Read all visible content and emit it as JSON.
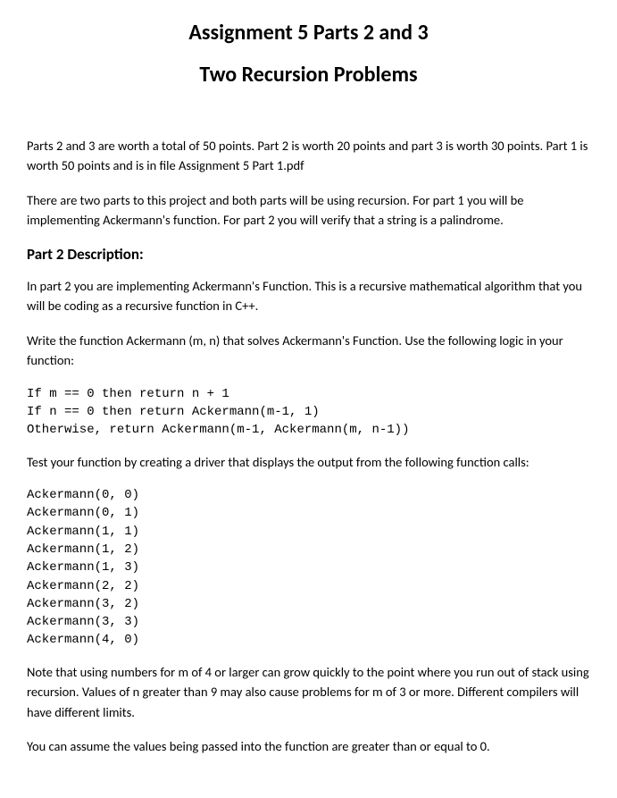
{
  "title": "Assignment 5 Parts 2 and 3",
  "subtitle": "Two Recursion Problems",
  "paragraphs": {
    "intro1": "Parts 2 and 3 are worth a total of 50 points. Part 2 is worth 20 points and part 3 is worth 30 points. Part 1 is worth 50 points and is in file Assignment 5 Part 1.pdf",
    "intro2": "There are two parts to this project and both parts will be using recursion. For part 1 you will be implementing Ackermann's function. For part 2 you will verify that a string is a palindrome.",
    "part2_heading": "Part 2 Description:",
    "part2_p1": "In part 2 you are implementing Ackermann's Function. This is a recursive mathematical algorithm that you will be coding as a recursive function in C++.",
    "part2_p2": "Write the function Ackermann (m, n) that solves Ackermann's Function. Use the following logic in your function:",
    "code_logic": "If m == 0 then return n + 1\nIf n == 0 then return Ackermann(m-1, 1)\nOtherwise, return Ackermann(m-1, Ackermann(m, n-1))",
    "part2_p3": "Test your function by creating a driver that displays the output from the following function calls:",
    "code_calls": "Ackermann(0, 0)\nAckermann(0, 1)\nAckermann(1, 1)\nAckermann(1, 2)\nAckermann(1, 3)\nAckermann(2, 2)\nAckermann(3, 2)\nAckermann(3, 3)\nAckermann(4, 0)",
    "part2_p4": "Note that using numbers for m of 4 or larger can grow quickly to the point where you run out of stack using recursion. Values of n greater than 9 may also cause problems for m of 3 or more. Different compilers will have different limits.",
    "part2_p5": "You can assume the values being passed into the function are greater than or equal to 0."
  }
}
